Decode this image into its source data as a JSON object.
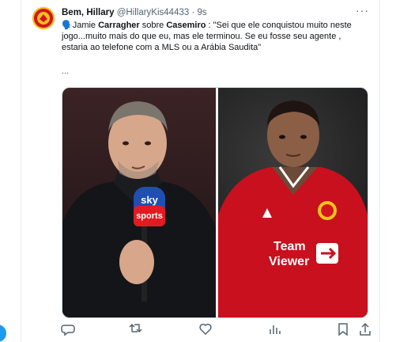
{
  "tweet": {
    "author_name": "Bem, Hillary",
    "handle": "@HillaryKis44433",
    "separator": "·",
    "time": "9s",
    "more": "···",
    "text_prefix_emoji": "🗣️",
    "text_person1": "Jamie ",
    "text_person1_bold": "Carragher",
    "text_mid": " sobre ",
    "text_person2_bold": "Casemiro",
    "text_quote": " : \"Sei que ele conquistou muito neste jogo...muito mais do que eu, mas ele terminou. Se eu fosse seu agente , estaria ao telefone com a MLS ou a Arábia Saudita\"",
    "ellipsis": "..."
  },
  "media": {
    "mic_brand_top": "sky",
    "mic_brand_bottom": "sports",
    "sponsor_line1": "Team",
    "sponsor_line2": "Viewer"
  },
  "actions": {
    "reply": "reply-icon",
    "retweet": "retweet-icon",
    "like": "heart-icon",
    "views": "views-icon",
    "bookmark": "bookmark-icon",
    "share": "share-icon"
  },
  "colors": {
    "accent": "#1d9bf0",
    "secondary_text": "#536471",
    "united_red": "#d4141f",
    "sky_blue": "#1f4fb3"
  }
}
